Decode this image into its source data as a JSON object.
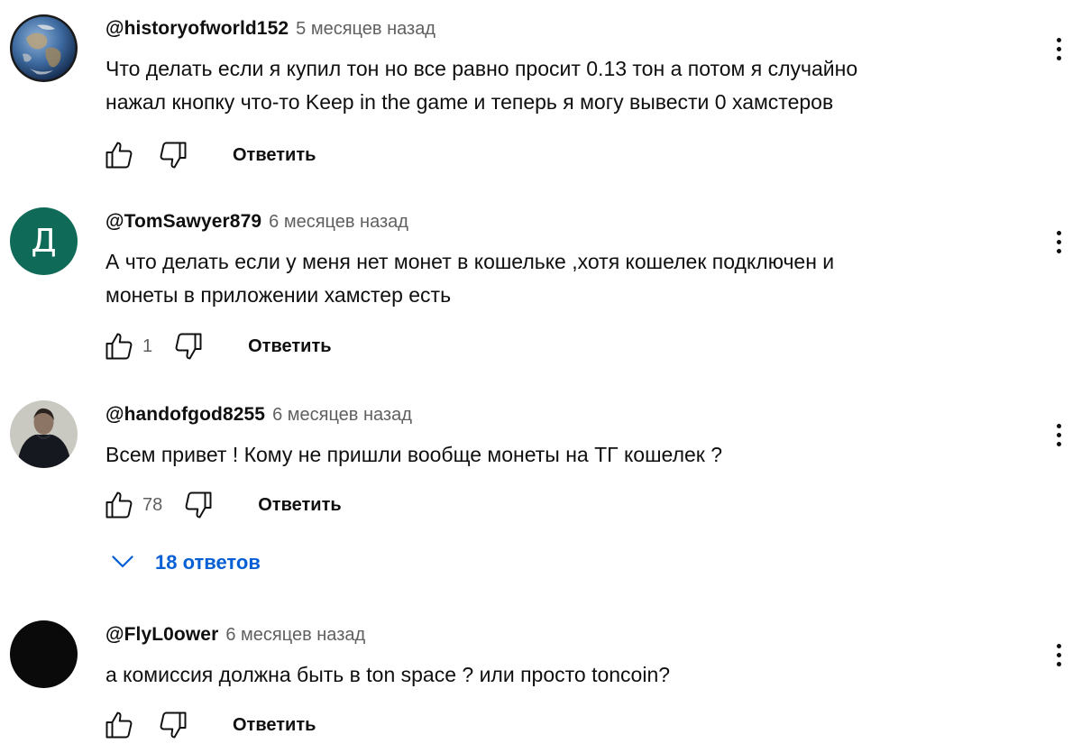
{
  "comments": [
    {
      "author": "@historyofworld152",
      "time": "5 месяцев назад",
      "text_lines": [
        "Что делать если я купил тон но все равно просит 0.13 тон а потом я случайно",
        "нажал кнопку что-то Keep in the game и теперь я могу вывести 0 хамстеров"
      ],
      "likes": "",
      "reply_label": "Ответить",
      "avatar": {
        "type": "earth-image"
      }
    },
    {
      "author": "@TomSawyer879",
      "time": "6 месяцев назад",
      "text_lines": [
        "А что делать если у меня нет монет в кошельке ,хотя кошелек подключен и",
        "монеты в приложении хамстер есть"
      ],
      "likes": "1",
      "reply_label": "Ответить",
      "avatar": {
        "type": "letter",
        "letter": "Д",
        "color": "#0f6b57"
      }
    },
    {
      "author": "@handofgod8255",
      "time": "6 месяцев назад",
      "text_lines": [
        "Всем привет ! Кому не пришли вообще монеты на ТГ кошелек ?"
      ],
      "likes": "78",
      "reply_label": "Ответить",
      "replies_label": "18 ответов",
      "avatar": {
        "type": "person-photo"
      }
    },
    {
      "author": "@FlyL0ower",
      "time": "6 месяцев назад",
      "text_lines": [
        "а комиссия должна быть в ton space ? или просто toncoin?"
      ],
      "likes": "",
      "reply_label": "Ответить",
      "avatar": {
        "type": "black-circle",
        "color": "#0a0a0a"
      }
    }
  ],
  "colors": {
    "link": "#065fd4",
    "secondary_text": "#606060",
    "primary_text": "#0f0f0f"
  },
  "icons": [
    "thumbs-up-icon",
    "thumbs-down-icon",
    "more-vert-icon",
    "chevron-down-icon"
  ]
}
